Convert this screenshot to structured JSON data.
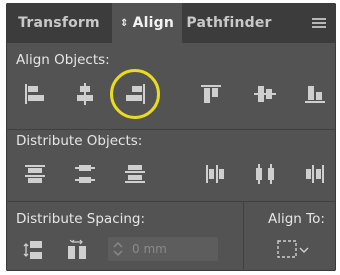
{
  "tabs": [
    {
      "label": "Transform",
      "active": false
    },
    {
      "label": "Align",
      "active": true,
      "indicator": "⇕"
    },
    {
      "label": "Pathfinder",
      "active": false
    }
  ],
  "panel_menu_icon": "hamburger-menu-icon",
  "sections": {
    "align_objects": {
      "label": "Align Objects:",
      "buttons": [
        {
          "name": "horizontal-align-left",
          "highlighted": false
        },
        {
          "name": "horizontal-align-center",
          "highlighted": false
        },
        {
          "name": "horizontal-align-right",
          "highlighted": true
        },
        {
          "name": "vertical-align-top",
          "highlighted": false
        },
        {
          "name": "vertical-align-center",
          "highlighted": false
        },
        {
          "name": "vertical-align-bottom",
          "highlighted": false
        }
      ]
    },
    "distribute_objects": {
      "label": "Distribute Objects:",
      "buttons": [
        {
          "name": "vertical-distribute-top"
        },
        {
          "name": "vertical-distribute-center"
        },
        {
          "name": "vertical-distribute-bottom"
        },
        {
          "name": "horizontal-distribute-left"
        },
        {
          "name": "horizontal-distribute-center"
        },
        {
          "name": "horizontal-distribute-right"
        }
      ]
    },
    "distribute_spacing": {
      "label": "Distribute Spacing:",
      "buttons": [
        {
          "name": "vertical-distribute-space"
        },
        {
          "name": "horizontal-distribute-space"
        }
      ],
      "spacing_value": "0 mm"
    },
    "align_to": {
      "label": "Align To:",
      "icon": "align-to-selection-icon"
    }
  },
  "colors": {
    "panel_bg": "#535353",
    "tabbar_bg": "#3c3c3c",
    "icon": "#cfcfcf",
    "highlight_ring": "#e8dc1e"
  }
}
